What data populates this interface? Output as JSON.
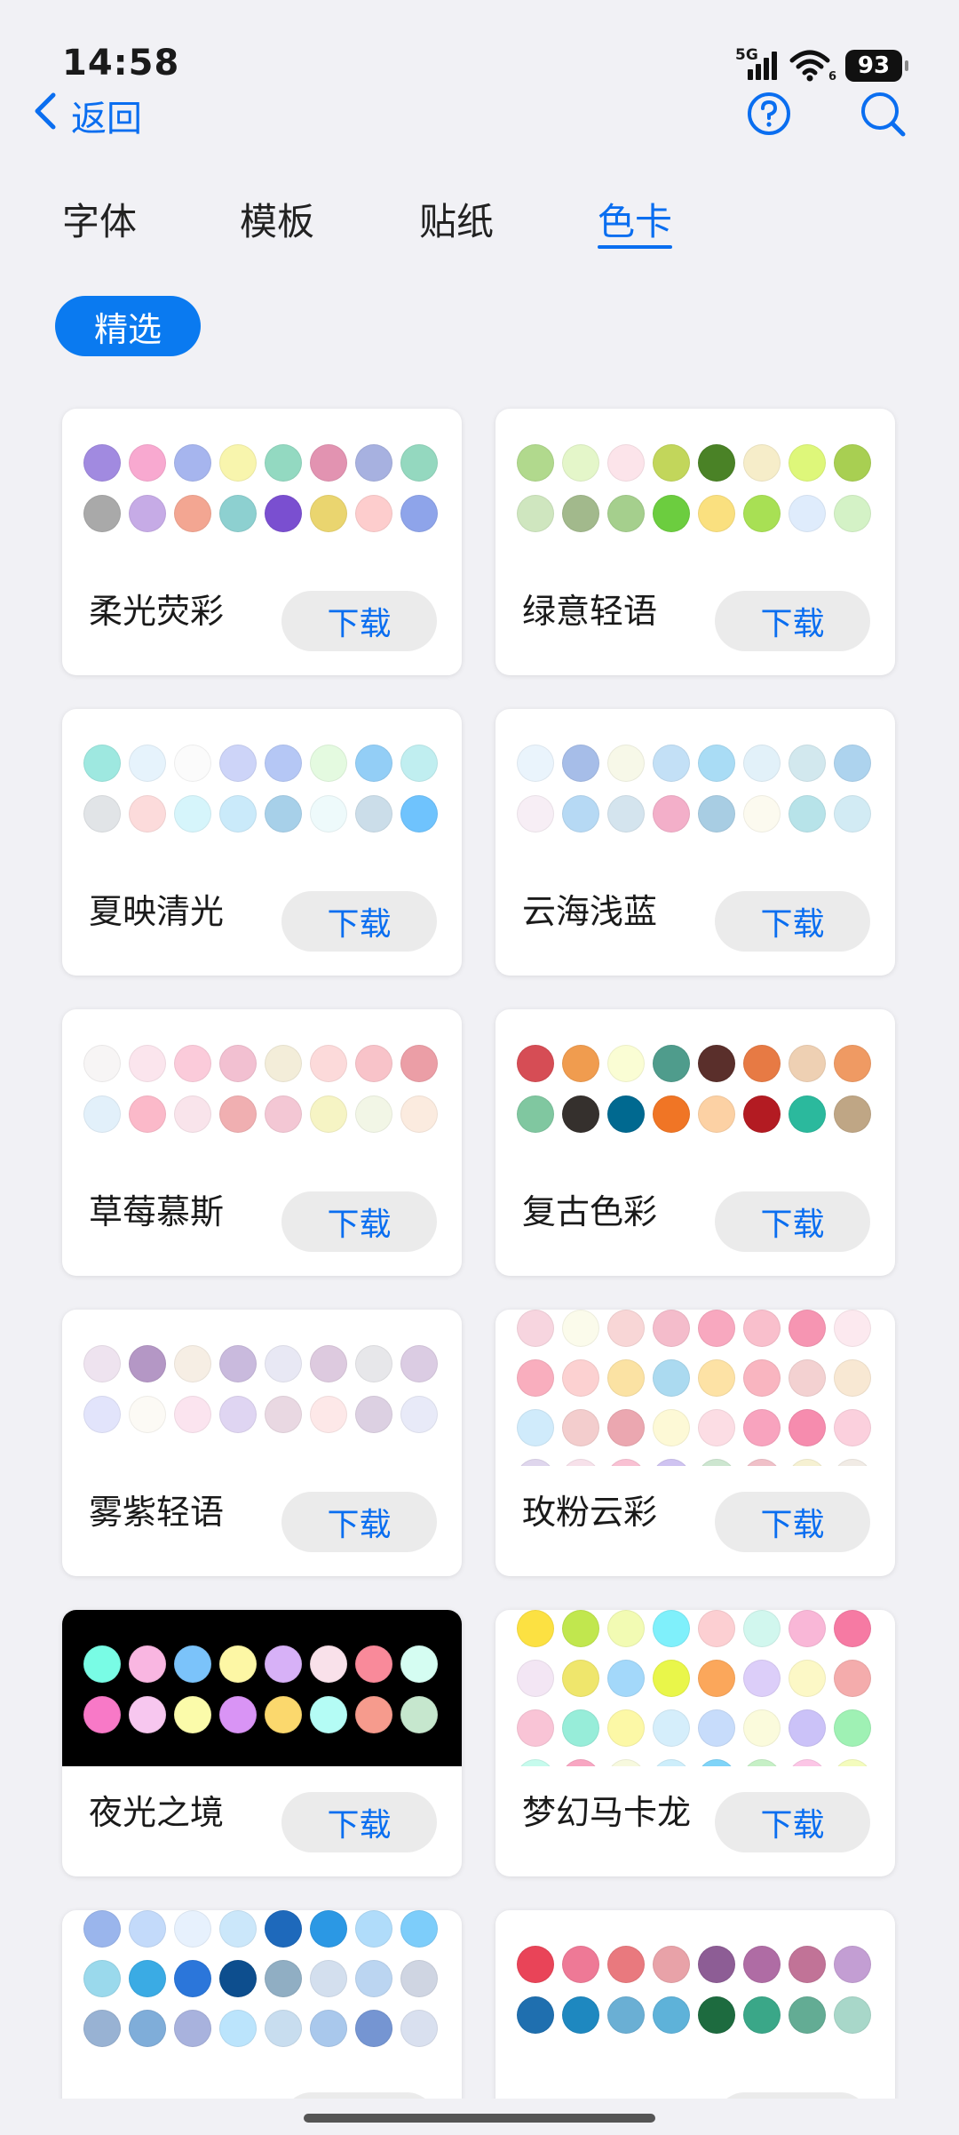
{
  "status_bar": {
    "time": "14:58",
    "network": "5G",
    "wifi_level": "6",
    "battery": "93"
  },
  "nav": {
    "back_label": "返回",
    "help_icon": "help-circle-icon",
    "search_icon": "search-icon"
  },
  "tabs": [
    {
      "label": "字体",
      "active": false
    },
    {
      "label": "模板",
      "active": false
    },
    {
      "label": "贴纸",
      "active": false
    },
    {
      "label": "色卡",
      "active": true
    }
  ],
  "filter_chip": {
    "label": "精选"
  },
  "accent_color": "#0a6ef0",
  "download_label": "下载",
  "cards": [
    {
      "name": "柔光荧彩",
      "dark": false,
      "colors": [
        [
          "#a18ae0",
          "#f8a9d0",
          "#a6b5ee",
          "#f8f5ad",
          "#93d9c1",
          "#e293b1",
          "#a7b1e0",
          "#94d8bf"
        ],
        [
          "#a9a9a9",
          "#c6abe6",
          "#f3a692",
          "#8dd0d0",
          "#7a4fd0",
          "#ead56f",
          "#fdcdcd",
          "#8ea4ea"
        ]
      ]
    },
    {
      "name": "绿意轻语",
      "dark": false,
      "colors": [
        [
          "#b1d98d",
          "#e4f6c9",
          "#fce4ea",
          "#c2d65b",
          "#4a8226",
          "#f6edc9",
          "#def77a",
          "#a8cf52"
        ],
        [
          "#cfe6bf",
          "#a2b98c",
          "#a5cf8d",
          "#6ccd3f",
          "#fae07f",
          "#a8e054",
          "#dfecfc",
          "#d4f2c6"
        ]
      ]
    },
    {
      "name": "夏映清光",
      "dark": false,
      "colors": [
        [
          "#9ee8e0",
          "#e6f3fc",
          "#fbfbfb",
          "#cdd4f8",
          "#b5c7f5",
          "#e4fae0",
          "#93cef6",
          "#c0eef0"
        ],
        [
          "#e1e4e7",
          "#fcdbdb",
          "#d6f5fb",
          "#caeafa",
          "#a7d0e9",
          "#eefafb",
          "#cbdde9",
          "#6fc3fd"
        ]
      ]
    },
    {
      "name": "云海浅蓝",
      "dark": false,
      "colors": [
        [
          "#eaf4fc",
          "#a6bde8",
          "#f7f8e8",
          "#c3e0f6",
          "#a9dcf5",
          "#e2f1f9",
          "#d2e8ee",
          "#add3ee"
        ],
        [
          "#f7eef5",
          "#b6d9f4",
          "#d4e4ee",
          "#f3afc9",
          "#a8cde3",
          "#fcfaef",
          "#b7e3e9",
          "#d2ebf4"
        ]
      ]
    },
    {
      "name": "草莓慕斯",
      "dark": false,
      "colors": [
        [
          "#f7f5f5",
          "#fbe5ed",
          "#fbcbda",
          "#f2c0d1",
          "#f3edd9",
          "#fcdada",
          "#f8c3c9",
          "#eb9ea6"
        ],
        [
          "#e2f0fa",
          "#fbb9c9",
          "#f9e4eb",
          "#f0afb1",
          "#f3c7d4",
          "#f6f4c4",
          "#f2f6e6",
          "#fbebdf"
        ]
      ]
    },
    {
      "name": "复古色彩",
      "dark": false,
      "colors": [
        [
          "#d64d55",
          "#f09c4f",
          "#fafdd4",
          "#4f9c8c",
          "#5a2f2b",
          "#e77a44",
          "#eed0b3",
          "#ef9a63"
        ],
        [
          "#80c7a0",
          "#35302d",
          "#006990",
          "#f07525",
          "#fcd1a4",
          "#b31b22",
          "#2bb99d",
          "#bfa685"
        ]
      ]
    },
    {
      "name": "雾紫轻语",
      "dark": false,
      "colors": [
        [
          "#eee3ef",
          "#b497c5",
          "#f6eee4",
          "#c9badd",
          "#e8e8f4",
          "#ddcadf",
          "#e7e7ea",
          "#dbcce3"
        ],
        [
          "#e2e4fb",
          "#fcfaf5",
          "#fbe4ef",
          "#dfd5f2",
          "#e9d8e2",
          "#fde8e8",
          "#dcd0e2",
          "#e8eaf8"
        ]
      ]
    },
    {
      "name": "玫粉云彩",
      "dark": false,
      "colors": [
        [
          "#f7d5df",
          "#fbfbeb",
          "#f8d6d6",
          "#f4bccb",
          "#f8a8bf",
          "#f9bfcc",
          "#f695b2",
          "#fce9ef"
        ],
        [
          "#f9aebe",
          "#fcd1d1",
          "#fbe2a3",
          "#abdaf0",
          "#fde2a5",
          "#f9b5c0",
          "#f3d1d1",
          "#f8e8d3"
        ],
        [
          "#d0ebfb",
          "#f3cdcd",
          "#eba7b0",
          "#fdf9d6",
          "#fcdde4",
          "#f8a3be",
          "#f68cae",
          "#fbd0dd"
        ],
        [
          "#dfd6ed",
          "#f7e1ea",
          "#f9c1d3",
          "#cfc3f1",
          "#cde6d0",
          "#f0c0c8",
          "#f6f1d2",
          "#f1ebe5"
        ]
      ]
    },
    {
      "name": "夜光之境",
      "dark": true,
      "colors": [
        [
          "#79fce5",
          "#f9b6e1",
          "#7bc3fa",
          "#fdf7a5",
          "#d7b1f7",
          "#f9e1ea",
          "#f98a9a",
          "#d5fdf2"
        ],
        [
          "#f879c7",
          "#f7c7ef",
          "#fbfbaa",
          "#d994f5",
          "#fbd86d",
          "#b4fcf5",
          "#f69b8d",
          "#c6e7ce"
        ]
      ]
    },
    {
      "name": "梦幻马卡龙",
      "dark": false,
      "colors": [
        [
          "#fce142",
          "#c1e74e",
          "#f2fbb3",
          "#7ff0fb",
          "#fccfd2",
          "#d1f7ee",
          "#f9b7d7",
          "#f67aa3"
        ],
        [
          "#f3e6f4",
          "#efe66c",
          "#a3d8fa",
          "#e9f64a",
          "#fba75b",
          "#dccef9",
          "#fcf8c6",
          "#f4acac"
        ],
        [
          "#f9c4d6",
          "#97edd9",
          "#fcf8a6",
          "#d5eefb",
          "#c7dcfb",
          "#fbfbdc",
          "#cbc2f8",
          "#9ff1b4"
        ],
        [
          "#c6fbed",
          "#f8a6c2",
          "#f7f9de",
          "#cdeefb",
          "#7fd4f8",
          "#c6f0c6",
          "#fcc6e6",
          "#f4fcbd"
        ]
      ]
    },
    {
      "name": "",
      "dark": false,
      "colors": [
        [
          "#9ab5ec",
          "#c3dafa",
          "#e7f1fd",
          "#cbe7fa",
          "#1e69bb",
          "#2b98e4",
          "#b0dcfa",
          "#7dcdfa"
        ],
        [
          "#9ad9ec",
          "#3aabe4",
          "#2b76da",
          "#0d4e8e",
          "#90aec3",
          "#d3dfee",
          "#bbd5f1",
          "#cfd5e2"
        ],
        [
          "#98b2d3",
          "#7fadd9",
          "#a8b2dd",
          "#bbe4fc",
          "#c8ddef",
          "#a9c8ec",
          "#7595d2",
          "#d9e0ef"
        ]
      ]
    },
    {
      "name": "",
      "dark": false,
      "colors": [
        [
          "#e94458",
          "#ee7996",
          "#e9797e",
          "#e8a2a8",
          "#8d5d95",
          "#af6ca4",
          "#c17397",
          "#c39ed3"
        ],
        [
          "#1f6faf",
          "#1e88c0",
          "#6aafd4",
          "#5eb2d9",
          "#1d6b3f",
          "#3aa788",
          "#63ac94",
          "#a8d7c9"
        ]
      ]
    }
  ]
}
